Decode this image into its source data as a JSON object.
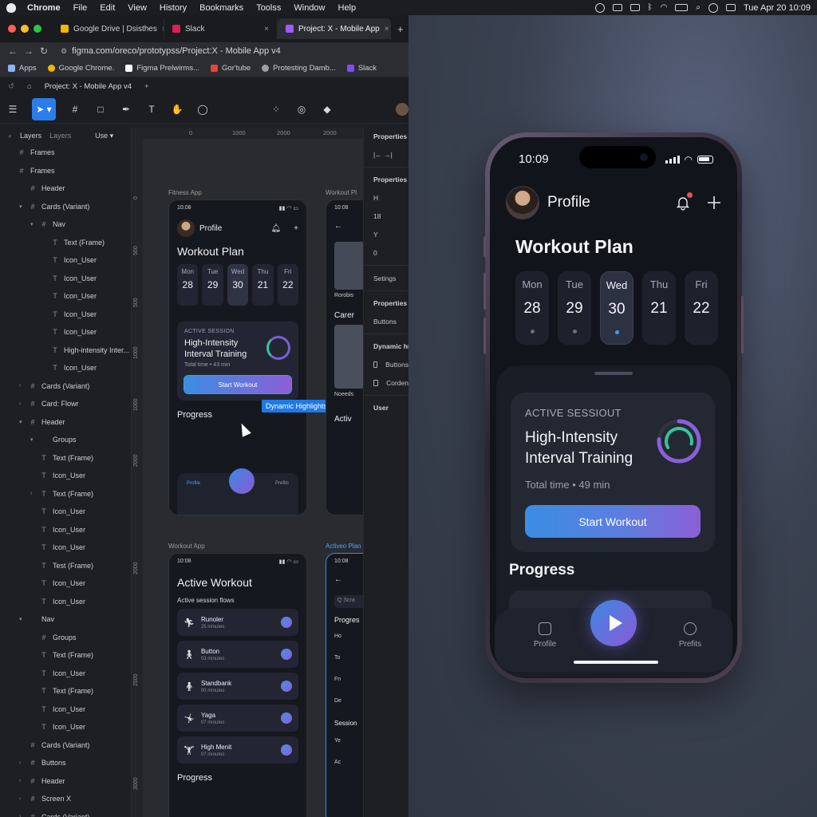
{
  "menubar": {
    "app": "Chrome",
    "items": [
      "File",
      "Edit",
      "View",
      "History",
      "Bookmarks",
      "Toolss",
      "Window",
      "Help"
    ],
    "clock": "Tue Apr 20  10:09"
  },
  "browser": {
    "tabs": [
      {
        "label": "Google Drive | Dsisthes",
        "favicon_color": "#f4b400"
      },
      {
        "label": "Slack",
        "favicon_color": "#e01e5a"
      },
      {
        "label": "Project: X - Mobile App",
        "favicon_color": "#a259ff"
      }
    ],
    "url": "figma.com/oreco/prototypss/Project:X - Mobile App v4",
    "bookmarks": [
      {
        "label": "Apps",
        "color": "#8ab4f8"
      },
      {
        "label": "Google Chrome.",
        "color": "#f4b400"
      },
      {
        "label": "Figma Prelwirms...",
        "color": "#ffffff"
      },
      {
        "label": "Gor'tube",
        "color": "#ea4335"
      },
      {
        "label": "Protesting Damb...",
        "color": "#9aa0a6"
      },
      {
        "label": "Slack",
        "color": "#7c4dff"
      }
    ]
  },
  "figma": {
    "file_tab": "Project: X - Mobile App v4",
    "layers_tabs": [
      "Layers",
      "Layers",
      "Use ▾"
    ],
    "ruler_top": [
      "0",
      "1000",
      "2000",
      "2000"
    ],
    "ruler_left": [
      "0",
      "500",
      "500",
      "1000",
      "1000",
      "2000",
      "2000",
      "2500",
      "3000"
    ],
    "layers": [
      {
        "label": "Frames",
        "indent": 0,
        "glyph": "#",
        "caret": ""
      },
      {
        "label": "Frames",
        "indent": 0,
        "glyph": "#",
        "caret": ""
      },
      {
        "label": "Header",
        "indent": 1,
        "glyph": "#",
        "caret": ""
      },
      {
        "label": "Cards (Variant)",
        "indent": 1,
        "glyph": "#",
        "caret": "▾"
      },
      {
        "label": "Nav",
        "indent": 2,
        "glyph": "#",
        "caret": "▾"
      },
      {
        "label": "Text (Frame)",
        "indent": 3,
        "glyph": "T",
        "caret": ""
      },
      {
        "label": "Icon_User",
        "indent": 3,
        "glyph": "T",
        "caret": ""
      },
      {
        "label": "Icon_User",
        "indent": 3,
        "glyph": "T",
        "caret": ""
      },
      {
        "label": "Icon_User",
        "indent": 3,
        "glyph": "T",
        "caret": ""
      },
      {
        "label": "Icon_User",
        "indent": 3,
        "glyph": "T",
        "caret": ""
      },
      {
        "label": "Icon_User",
        "indent": 3,
        "glyph": "T",
        "caret": ""
      },
      {
        "label": "High-intensity Inter...",
        "indent": 3,
        "glyph": "T",
        "caret": ""
      },
      {
        "label": "Icon_User",
        "indent": 3,
        "glyph": "T",
        "caret": ""
      },
      {
        "label": "Cards (Variant)",
        "indent": 1,
        "glyph": "#",
        "caret": "›"
      },
      {
        "label": "Card: Flowr",
        "indent": 1,
        "glyph": "#",
        "caret": "›"
      },
      {
        "label": "Header",
        "indent": 1,
        "glyph": "#",
        "caret": "▾"
      },
      {
        "label": "Groups",
        "indent": 2,
        "glyph": "",
        "caret": "▾"
      },
      {
        "label": "Text (Frame)",
        "indent": 2,
        "glyph": "T",
        "caret": ""
      },
      {
        "label": "Icon_User",
        "indent": 2,
        "glyph": "T",
        "caret": ""
      },
      {
        "label": "Text (Frame)",
        "indent": 2,
        "glyph": "T",
        "caret": "›"
      },
      {
        "label": "Icon_User",
        "indent": 2,
        "glyph": "T",
        "caret": ""
      },
      {
        "label": "Icon_User",
        "indent": 2,
        "glyph": "T",
        "caret": ""
      },
      {
        "label": "Icon_User",
        "indent": 2,
        "glyph": "T",
        "caret": ""
      },
      {
        "label": "Test (Frame)",
        "indent": 2,
        "glyph": "T",
        "caret": ""
      },
      {
        "label": "Icon_User",
        "indent": 2,
        "glyph": "T",
        "caret": ""
      },
      {
        "label": "Icon_User",
        "indent": 2,
        "glyph": "T",
        "caret": ""
      },
      {
        "label": "Nav",
        "indent": 1,
        "glyph": "",
        "caret": "▾"
      },
      {
        "label": "Groups",
        "indent": 2,
        "glyph": "#",
        "caret": ""
      },
      {
        "label": "Text (Frame)",
        "indent": 2,
        "glyph": "T",
        "caret": ""
      },
      {
        "label": "Icon_User",
        "indent": 2,
        "glyph": "T",
        "caret": ""
      },
      {
        "label": "Text (Frame)",
        "indent": 2,
        "glyph": "T",
        "caret": ""
      },
      {
        "label": "Icon_User",
        "indent": 2,
        "glyph": "T",
        "caret": ""
      },
      {
        "label": "Icon_User",
        "indent": 2,
        "glyph": "T",
        "caret": ""
      },
      {
        "label": "Cards (Variant)",
        "indent": 1,
        "glyph": "#",
        "caret": ""
      },
      {
        "label": "Buttons",
        "indent": 1,
        "glyph": "#",
        "caret": "›"
      },
      {
        "label": "Header",
        "indent": 1,
        "glyph": "#",
        "caret": "›"
      },
      {
        "label": "Screen X",
        "indent": 1,
        "glyph": "#",
        "caret": "›"
      },
      {
        "label": "Cards (Variant)",
        "indent": 1,
        "glyph": "#",
        "caret": "›"
      }
    ],
    "frame_labels": {
      "fitness": "Fitness App",
      "workout_top": "Workout Pl",
      "workout_app": "Workout App",
      "active_plan": "Activeo Plan"
    },
    "tooltip": "Dynamic Highlights",
    "properties": [
      {
        "type": "head",
        "label": "Properties"
      },
      {
        "type": "row",
        "label": "|←   →|"
      },
      {
        "type": "sep"
      },
      {
        "type": "head",
        "label": "Properties"
      },
      {
        "type": "row",
        "label": "H"
      },
      {
        "type": "row",
        "label": "18"
      },
      {
        "type": "row",
        "label": "Y"
      },
      {
        "type": "row",
        "label": "0"
      },
      {
        "type": "sep"
      },
      {
        "type": "row",
        "label": "Setings"
      },
      {
        "type": "sep"
      },
      {
        "type": "head",
        "label": "Properties"
      },
      {
        "type": "row",
        "label": "Buttons"
      },
      {
        "type": "sep"
      },
      {
        "type": "head",
        "label": "Dynamic hi"
      },
      {
        "type": "check",
        "label": "Buttons"
      },
      {
        "type": "check",
        "label": "Corden"
      },
      {
        "type": "sep"
      },
      {
        "type": "head",
        "label": "User"
      }
    ]
  },
  "mini_fitness": {
    "time": "10:08",
    "profile": "Profile",
    "title": "Workout Plan",
    "days": [
      {
        "d": "Mon",
        "n": "28"
      },
      {
        "d": "Tue",
        "n": "29"
      },
      {
        "d": "Wed",
        "n": "30"
      },
      {
        "d": "Thu",
        "n": "21"
      },
      {
        "d": "Fri",
        "n": "22"
      }
    ],
    "eyebrow": "ACTIVE SESSION",
    "card_title": "High-Intensity Interval Training",
    "card_sub": "Total time • 43 min",
    "button": "Start Workout",
    "section": "Progress",
    "progress_item": "Profile",
    "tabs": [
      "Profile",
      "Prefits"
    ]
  },
  "mini_workout": {
    "time": "10:08",
    "title": "Active Workout",
    "sub": "Active session flows",
    "items": [
      {
        "t": "Runoler",
        "s": "25 minutes"
      },
      {
        "t": "Button",
        "s": "03 minutes"
      },
      {
        "t": "Standbank",
        "s": "00 minutes"
      },
      {
        "t": "Yaga",
        "s": "07 minutes"
      },
      {
        "t": "High Menit",
        "s": "07 minutes"
      }
    ],
    "section": "Progress"
  },
  "mini_partial_top": {
    "time": "10:08",
    "labels": [
      "Rorobis",
      "Carer",
      "Noeeds",
      "Activ"
    ]
  },
  "mini_partial_bottom": {
    "time": "10:08",
    "labels": [
      "Q Scra",
      "Progres",
      "Ho",
      "To",
      "Fn",
      "De",
      "Session",
      "Ye",
      "Ac"
    ]
  },
  "phone": {
    "time": "10:09",
    "profile": "Profile",
    "title": "Workout Plan",
    "days": [
      {
        "d": "Mon",
        "n": "28"
      },
      {
        "d": "Tue",
        "n": "29"
      },
      {
        "d": "Wed",
        "n": "30",
        "active": true
      },
      {
        "d": "Thu",
        "n": "21"
      },
      {
        "d": "Fri",
        "n": "22"
      }
    ],
    "eyebrow": "ACTIVE SESSIOUT",
    "card_title": "High-Intensity Interval Training",
    "card_sub": "Total time • 49 min",
    "button": "Start Workout",
    "section": "Progress",
    "tabs": [
      "Profile",
      "Prefits"
    ],
    "colors": {
      "accent_blue": "#3a8de3",
      "accent_purple": "#8c5fd6",
      "badge": "#f04e4e"
    }
  }
}
